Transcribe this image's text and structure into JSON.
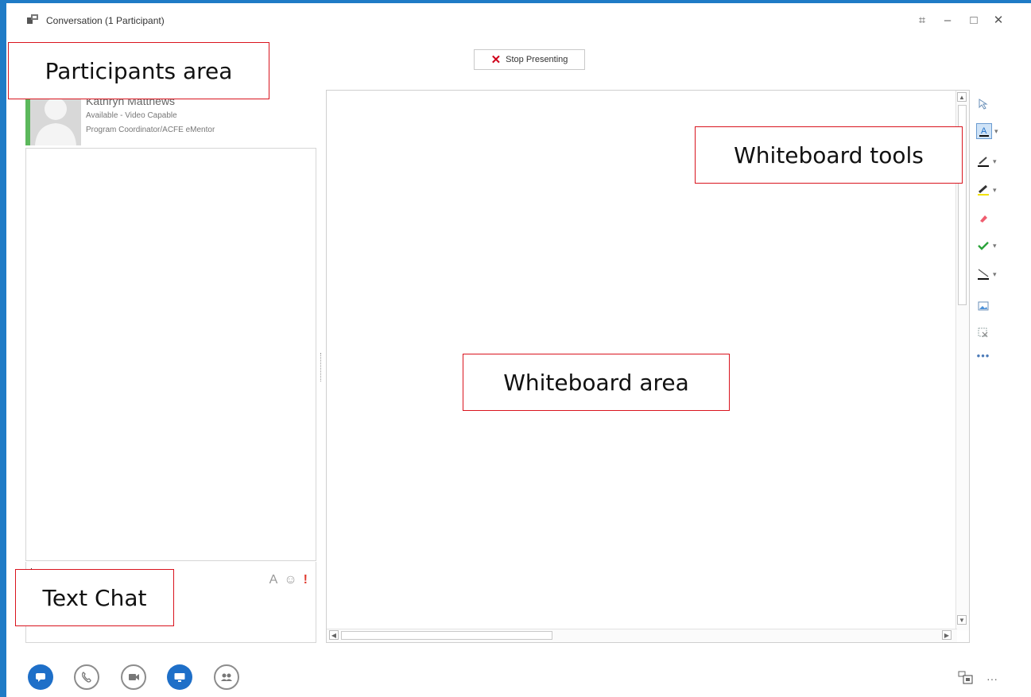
{
  "window": {
    "title": "Conversation (1 Participant)"
  },
  "window_controls": {
    "pin": "⌗",
    "minimize": "–",
    "maximize": "□",
    "close": "✕"
  },
  "stage": {
    "stop_presenting_label": "Stop Presenting"
  },
  "participant": {
    "name": "Kathryn Matthews",
    "status": "Available - Video Capable",
    "title": "Program Coordinator/ACFE eMentor",
    "presence_color": "#5cb85c"
  },
  "chat": {
    "tools": {
      "font": "A",
      "emoticon": "☺",
      "importance": "!"
    }
  },
  "annotations": {
    "participants_area": "Participants area",
    "whiteboard_tools": "Whiteboard tools",
    "whiteboard_area": "Whiteboard area",
    "text_chat": "Text Chat"
  },
  "whiteboard_tools": [
    {
      "name": "selector-tool-icon"
    },
    {
      "name": "type-text-tool-icon",
      "dropdown": true
    },
    {
      "name": "pen-tool-icon",
      "dropdown": true
    },
    {
      "name": "highlighter-tool-icon",
      "dropdown": true
    },
    {
      "name": "eraser-tool-icon"
    },
    {
      "name": "stamp-tool-icon",
      "dropdown": true
    },
    {
      "name": "shape-tool-icon",
      "dropdown": true
    },
    {
      "name": "insert-image-icon"
    },
    {
      "name": "delete-selected-icon"
    },
    {
      "name": "more-options-icon"
    }
  ],
  "bottom_bar": {
    "buttons": [
      "im-button",
      "call-button",
      "video-button",
      "present-button",
      "participants-button"
    ],
    "more_label": "···"
  },
  "colors": {
    "accent": "#1e6fc8",
    "annotation_border": "#d9141e",
    "desktop": "#1f7bc6"
  }
}
